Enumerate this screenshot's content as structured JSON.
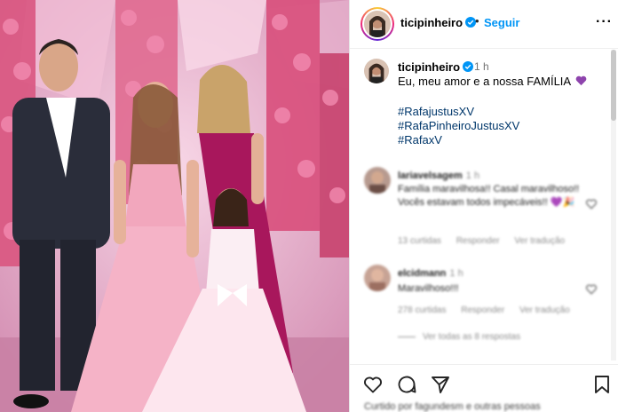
{
  "post": {
    "username": "ticipinheiro",
    "follow_label": "Seguir",
    "separator": "•",
    "more_label": "···",
    "photo_alt": "Foto de família com vestidos rosa e magenta"
  },
  "caption": {
    "username": "ticipinheiro",
    "time": "1 h",
    "text": "Eu, meu amor e a nossa FAMÍLIA",
    "hashtags": [
      "#RafajustusXV",
      "#RafaPinheiroJustusXV",
      "#RafaxV"
    ]
  },
  "comments": [
    {
      "username": "lariavelsagem",
      "time": "1 h",
      "text": "Família maravilhosa!! Casal maravilhoso!! Vocês estavam todos impecáveis!! 💜🎉",
      "likes": "13 curtidas",
      "reply": "Responder",
      "translate": "Ver tradução"
    },
    {
      "username": "elcidmann",
      "time": "1 h",
      "text": "Maravilhoso!!!",
      "likes": "278 curtidas",
      "reply": "Responder",
      "translate": "Ver tradução"
    }
  ],
  "view_replies": "Ver todas as 8 respostas",
  "likes_line": "Curtido por fagundesm e outras pessoas",
  "colors": {
    "accent": "#0095f6",
    "hashtag": "#00376b",
    "heart": "#8e44ad",
    "muted": "#737373"
  },
  "icons": [
    "verified-badge-icon",
    "more-options-icon",
    "heart-icon",
    "comment-icon",
    "share-icon",
    "save-icon",
    "purple-heart-emoji-icon"
  ]
}
